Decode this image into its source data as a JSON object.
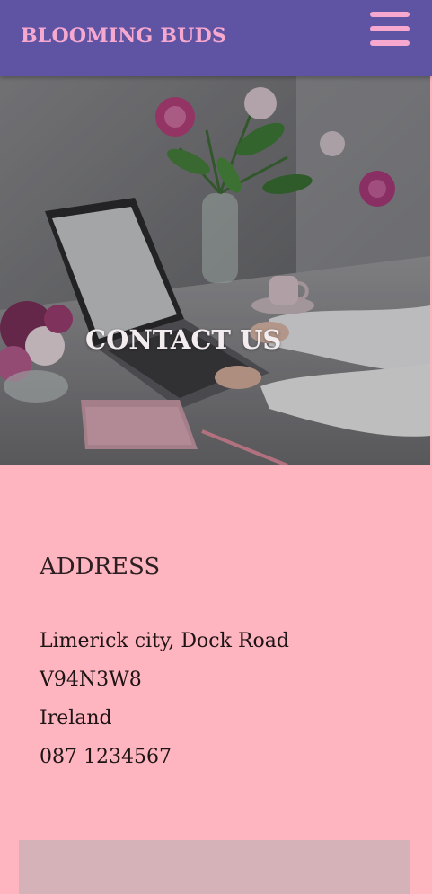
{
  "navbar": {
    "brand": "BLOOMING BUDS",
    "menu_icon": "hamburger-menu-icon"
  },
  "hero": {
    "title": "CONTACT US",
    "image": "laptop-flowers-desk-photo"
  },
  "contact": {
    "heading": "ADDRESS",
    "lines": [
      "Limerick city, Dock Road",
      "V94N3W8",
      "Ireland",
      "087 1234567"
    ]
  },
  "colors": {
    "navbar_bg": "#5f54a3",
    "brand_pink": "#f7a8cf",
    "page_bg": "#ffb5bf",
    "form_panel": "#d5b1b8"
  }
}
